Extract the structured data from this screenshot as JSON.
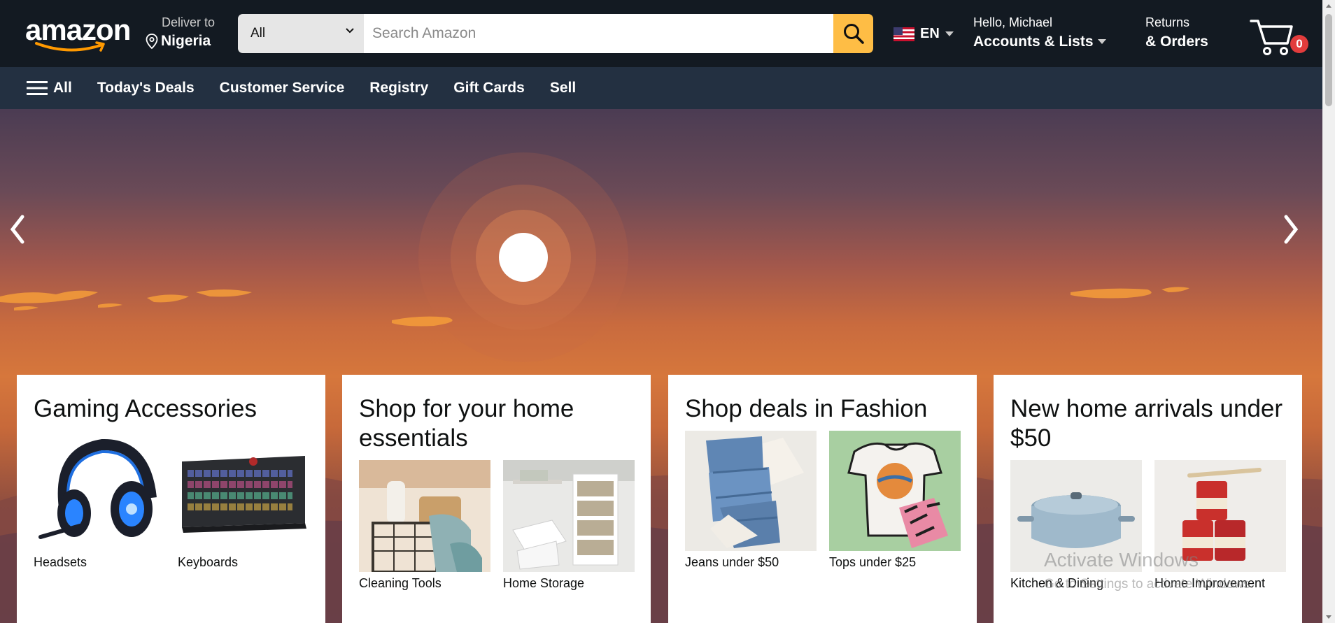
{
  "header": {
    "logo_text": "amazon",
    "deliver_label": "Deliver to",
    "deliver_location": "Nigeria",
    "search_category": "All",
    "search_placeholder": "Search Amazon",
    "language": "EN",
    "greeting": "Hello, Michael",
    "accounts_label": "Accounts & Lists",
    "returns_label": "Returns",
    "orders_label": "& Orders",
    "cart_count": "0"
  },
  "nav": {
    "all_label": "All",
    "items": [
      "Today's Deals",
      "Customer Service",
      "Registry",
      "Gift Cards",
      "Sell"
    ]
  },
  "cards": [
    {
      "title": "Gaming Accessories",
      "tiles": [
        "Headsets",
        "Keyboards"
      ]
    },
    {
      "title": "Shop for your home essentials",
      "tiles": [
        "Cleaning Tools",
        "Home Storage"
      ]
    },
    {
      "title": "Shop deals in Fashion",
      "tiles": [
        "Jeans under $50",
        "Tops under $25"
      ]
    },
    {
      "title": "New home arrivals under $50",
      "tiles": [
        "Kitchen & Dining",
        "Home Improvement"
      ]
    }
  ],
  "watermark": {
    "line1": "Activate Windows",
    "line2": "Go to Settings to activate Windows."
  },
  "colors": {
    "header_bg": "#131a22",
    "nav_bg": "#233041",
    "search_button": "#febd45",
    "cart_badge": "#e23c3c"
  }
}
